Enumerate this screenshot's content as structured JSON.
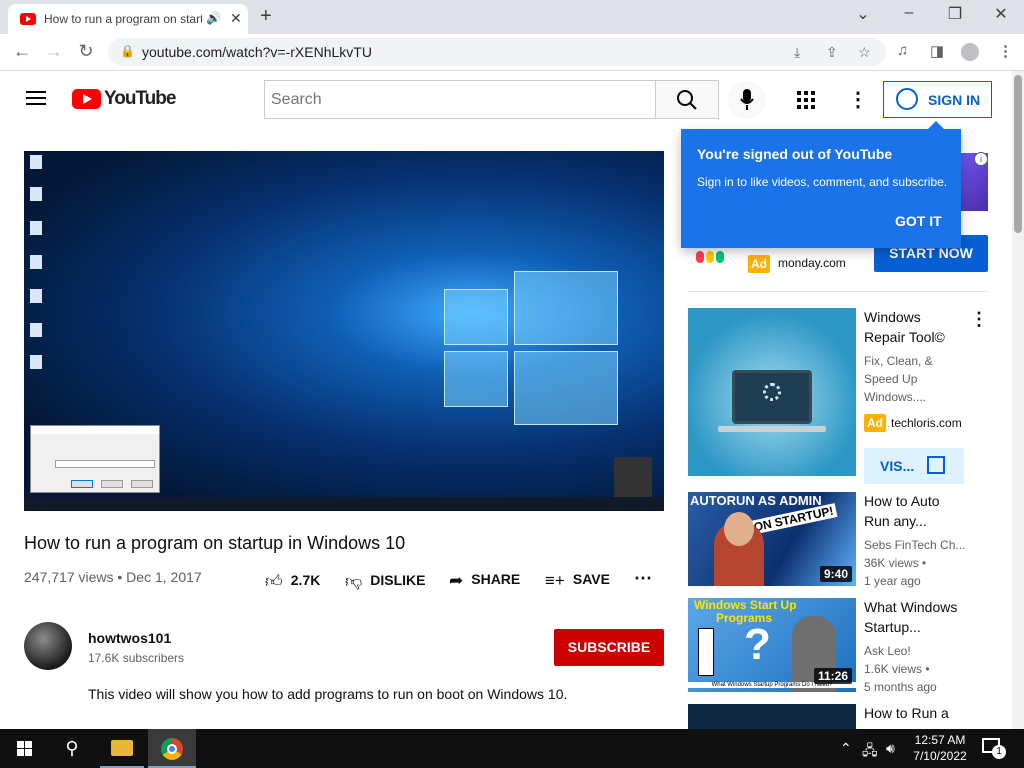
{
  "browser": {
    "tab_title": "How to run a program on startup in Windows 10",
    "url": "youtube.com/watch?v=-rXENhLkvTU",
    "new_tab": "+",
    "minimize": "–",
    "restore": "❐",
    "close": "✕",
    "tab_close": "✕",
    "tab_audio": "🔊"
  },
  "yt_header": {
    "logo_text": "YouTube",
    "search_placeholder": "Search",
    "sign_in": "SIGN IN",
    "more": "⋮"
  },
  "popup": {
    "title": "You're signed out of YouTube",
    "body": "Sign in to like videos, comment, and subscribe.",
    "button": "GOT IT"
  },
  "video": {
    "title": "How to run a program on startup in Windows 10",
    "meta": "247,717 views • Dec 1, 2017",
    "actions": {
      "like": "2.7K",
      "dislike": "DISLIKE",
      "share": "SHARE",
      "save": "SAVE",
      "more": "⋯"
    },
    "channel": {
      "name": "howtwos101",
      "subscribers": "17.6K subscribers",
      "subscribe": "SUBSCRIBE"
    },
    "description": "This video will show you how to add programs to run on boot on Windows 10."
  },
  "sidebar": {
    "ad1": {
      "badge": "Ad",
      "domain": "monday.com",
      "cta": "START NOW"
    },
    "ad2": {
      "title_line1": "Windows",
      "title_line2": "Repair Tool©",
      "desc_line1": "Fix, Clean, &",
      "desc_line2": "Speed Up",
      "desc_line3": "Windows....",
      "badge": "Ad",
      "domain": "techloris.com",
      "cta": "VIS..."
    },
    "videos": [
      {
        "title_line1": "How to Auto",
        "title_line2": "Run any...",
        "channel": "Sebs FinTech Ch...",
        "views": "36K views •",
        "age": "1 year ago",
        "duration": "9:40",
        "thumb_text1": "AUTORUN AS ADMIN",
        "thumb_text2": "ON STARTUP!"
      },
      {
        "title_line1": "What Windows",
        "title_line2": "Startup...",
        "channel": "Ask Leo!",
        "views": "1.6K views •",
        "age": "5 months ago",
        "duration": "11:26",
        "thumb_text1": "Windows Start Up",
        "thumb_text2": "Programs",
        "thumb_caption": "What Windows Startup Programs Do I Need?"
      },
      {
        "title_line1": "How to Run a"
      }
    ]
  },
  "taskbar": {
    "time": "12:57 AM",
    "date": "7/10/2022",
    "notifications": "1"
  }
}
